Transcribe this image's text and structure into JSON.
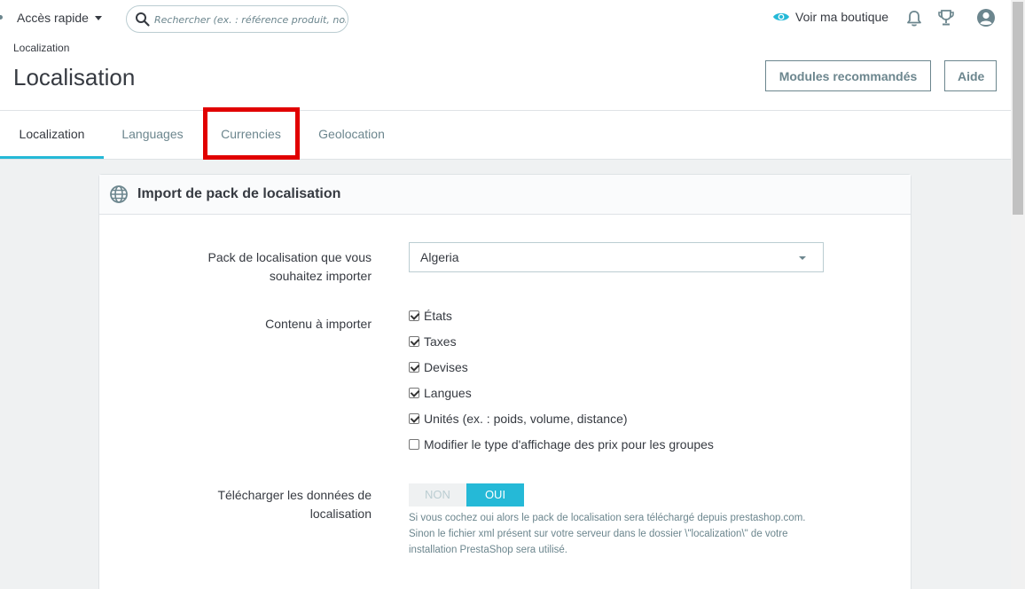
{
  "topbar": {
    "quick_access_label": "Accès rapide",
    "search_placeholder": "Rechercher (ex. : référence produit, nom",
    "view_shop_label": "Voir ma boutique"
  },
  "header": {
    "breadcrumb": "Localization",
    "title": "Localisation",
    "recommended_modules_label": "Modules recommandés",
    "help_label": "Aide"
  },
  "tabs": [
    {
      "label": "Localization",
      "active": true
    },
    {
      "label": "Languages",
      "active": false
    },
    {
      "label": "Currencies",
      "active": false
    },
    {
      "label": "Geolocation",
      "active": false
    }
  ],
  "panel": {
    "title": "Import de pack de localisation",
    "pack_label": "Pack de localisation que vous souhaitez importer",
    "pack_value": "Algeria",
    "content_label": "Contenu à importer",
    "content_items": [
      {
        "label": "États",
        "checked": true
      },
      {
        "label": "Taxes",
        "checked": true
      },
      {
        "label": "Devises",
        "checked": true
      },
      {
        "label": "Langues",
        "checked": true
      },
      {
        "label": "Unités (ex. : poids, volume, distance)",
        "checked": true
      },
      {
        "label": "Modifier le type d'affichage des prix pour les groupes",
        "checked": false
      }
    ],
    "download_label": "Télécharger les données de localisation",
    "switch_off": "NON",
    "switch_on": "OUI",
    "download_help": "Si vous cochez oui alors le pack de localisation sera téléchargé depuis prestashop.com. Sinon le fichier xml présent sur votre serveur dans le dossier \\\"localization\\\" de votre installation PrestaShop sera utilisé."
  },
  "colors": {
    "accent": "#25b9d7",
    "highlight": "#e10000"
  }
}
